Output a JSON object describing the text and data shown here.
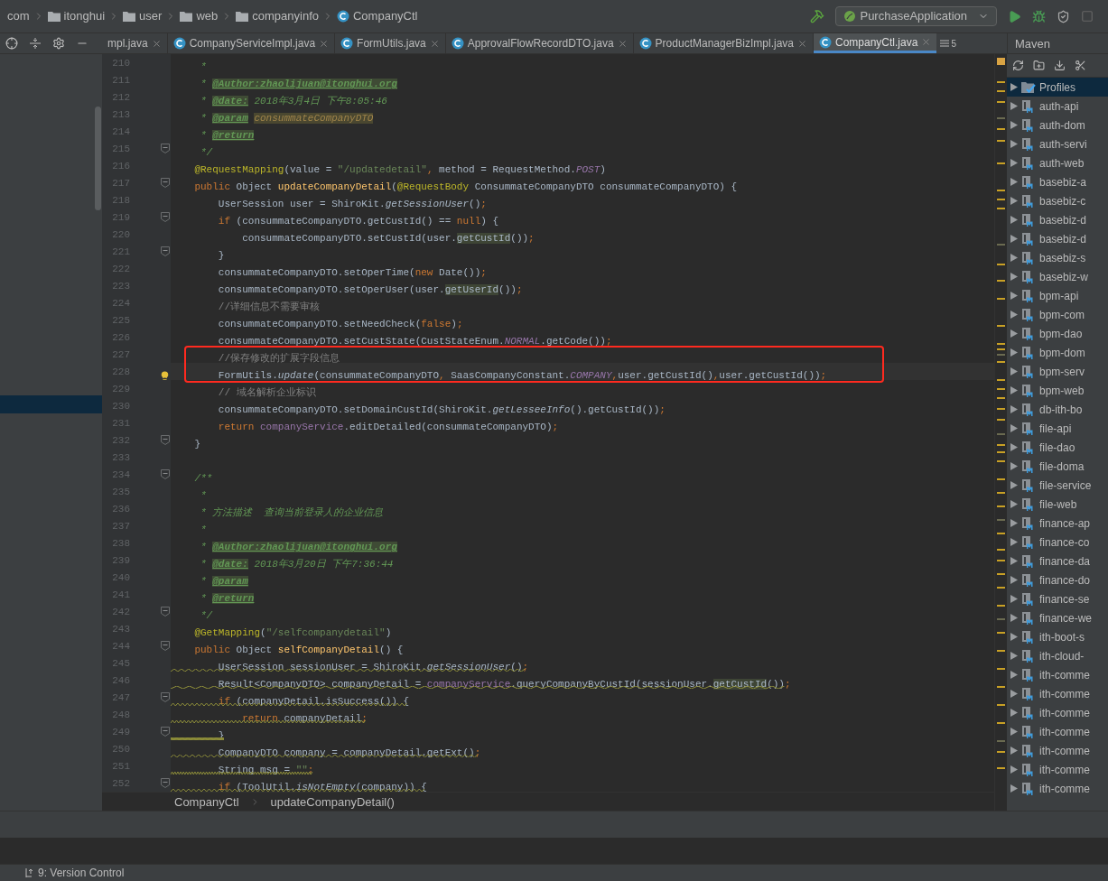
{
  "nav_bar": {
    "crumbs": [
      {
        "kind": "package",
        "label": "com"
      },
      {
        "kind": "folder",
        "label": "itonghui"
      },
      {
        "kind": "folder",
        "label": "user"
      },
      {
        "kind": "folder",
        "label": "web"
      },
      {
        "kind": "folder",
        "label": "companyinfo"
      },
      {
        "kind": "class",
        "label": "CompanyCtl"
      }
    ],
    "run_config": "PurchaseApplication"
  },
  "tabs": [
    {
      "label": "mpl.java",
      "selected": false
    },
    {
      "label": "CompanyServiceImpl.java",
      "selected": false
    },
    {
      "label": "FormUtils.java",
      "selected": false
    },
    {
      "label": "ApprovalFlowRecordDTO.java",
      "selected": false
    },
    {
      "label": "ProductManagerBizImpl.java",
      "selected": false
    },
    {
      "label": "CompanyCtl.java",
      "selected": true
    }
  ],
  "tab_overflow_count": "5",
  "editor": {
    "lines": [
      {
        "number": "210",
        "fold": false,
        "current": false,
        "warning": false,
        "tokens": [
          {
            "kind": "doc",
            "text": "     *"
          }
        ]
      },
      {
        "number": "211",
        "fold": false,
        "current": false,
        "warning": false,
        "tokens": [
          {
            "kind": "doc",
            "text": "     * "
          },
          {
            "kind": "doctag",
            "text": "@Author:zhaolijuan@itonghui.org"
          }
        ]
      },
      {
        "number": "212",
        "fold": false,
        "current": false,
        "warning": false,
        "tokens": [
          {
            "kind": "doc",
            "text": "     * "
          },
          {
            "kind": "doctag",
            "text": "@date:"
          },
          {
            "kind": "doc",
            "text": " 2018年3月4日 下午8:05:46"
          }
        ]
      },
      {
        "number": "213",
        "fold": false,
        "current": false,
        "warning": false,
        "tokens": [
          {
            "kind": "doc",
            "text": "     * "
          },
          {
            "kind": "doctag",
            "text": "@param"
          },
          {
            "kind": "docparam",
            "text": "consummateCompanyDTO"
          }
        ]
      },
      {
        "number": "214",
        "fold": false,
        "current": false,
        "warning": false,
        "tokens": [
          {
            "kind": "doc",
            "text": "     * "
          },
          {
            "kind": "doctag",
            "text": "@return"
          }
        ]
      },
      {
        "number": "215",
        "fold": true,
        "current": false,
        "warning": false,
        "tokens": [
          {
            "kind": "doc",
            "text": "     */"
          }
        ]
      },
      {
        "number": "216",
        "fold": false,
        "current": false,
        "warning": false,
        "tokens": [
          {
            "kind": "annotation",
            "text": "    @RequestMapping"
          },
          {
            "kind": "plain",
            "text": "(value = "
          },
          {
            "kind": "string",
            "text": "\"/updatedetail\""
          },
          {
            "kind": "keyword",
            "text": ","
          },
          {
            "kind": "plain",
            "text": " method = RequestMethod."
          },
          {
            "kind": "constant",
            "text": "POST"
          },
          {
            "kind": "plain",
            "text": ")"
          }
        ]
      },
      {
        "number": "217",
        "fold": true,
        "current": false,
        "warning": false,
        "tokens": [
          {
            "kind": "keyword",
            "text": "    public"
          },
          {
            "kind": "plain",
            "text": " Object "
          },
          {
            "kind": "method",
            "text": "updateCompanyDetail"
          },
          {
            "kind": "plain",
            "text": "("
          },
          {
            "kind": "annotation",
            "text": "@RequestBody"
          },
          {
            "kind": "plain",
            "text": " ConsummateCompanyDTO consummateCompanyDTO) {"
          }
        ]
      },
      {
        "number": "218",
        "fold": false,
        "current": false,
        "warning": false,
        "tokens": [
          {
            "kind": "plain",
            "text": "        UserSession user = ShiroKit."
          },
          {
            "kind": "static",
            "text": "getSessionUser"
          },
          {
            "kind": "plain",
            "text": "()"
          },
          {
            "kind": "keyword",
            "text": ";"
          }
        ]
      },
      {
        "number": "219",
        "fold": true,
        "current": false,
        "warning": false,
        "tokens": [
          {
            "kind": "keyword",
            "text": "        if"
          },
          {
            "kind": "plain",
            "text": " (consummateCompanyDTO.getCustId() == "
          },
          {
            "kind": "keyword",
            "text": "null"
          },
          {
            "kind": "plain",
            "text": ") {"
          }
        ]
      },
      {
        "number": "220",
        "fold": false,
        "current": false,
        "warning": false,
        "tokens": [
          {
            "kind": "plain",
            "text": "            consummateCompanyDTO.setCustId(user."
          },
          {
            "kind": "usage",
            "text": "getCustId"
          },
          {
            "kind": "plain",
            "text": "())"
          },
          {
            "kind": "keyword",
            "text": ";"
          }
        ]
      },
      {
        "number": "221",
        "fold": true,
        "current": false,
        "warning": false,
        "tokens": [
          {
            "kind": "plain",
            "text": "        }"
          }
        ]
      },
      {
        "number": "222",
        "fold": false,
        "current": false,
        "warning": false,
        "tokens": [
          {
            "kind": "plain",
            "text": "        consummateCompanyDTO.setOperTime("
          },
          {
            "kind": "keyword",
            "text": "new"
          },
          {
            "kind": "plain",
            "text": " Date())"
          },
          {
            "kind": "keyword",
            "text": ";"
          }
        ]
      },
      {
        "number": "223",
        "fold": false,
        "current": false,
        "warning": false,
        "tokens": [
          {
            "kind": "plain",
            "text": "        consummateCompanyDTO.setOperUser(user."
          },
          {
            "kind": "usage",
            "text": "getUserId"
          },
          {
            "kind": "plain",
            "text": "())"
          },
          {
            "kind": "keyword",
            "text": ";"
          }
        ]
      },
      {
        "number": "224",
        "fold": false,
        "current": false,
        "warning": false,
        "tokens": [
          {
            "kind": "comment",
            "text": "        //详细信息不需要审核"
          }
        ]
      },
      {
        "number": "225",
        "fold": false,
        "current": false,
        "warning": false,
        "tokens": [
          {
            "kind": "plain",
            "text": "        consummateCompanyDTO.setNeedCheck("
          },
          {
            "kind": "keyword",
            "text": "false"
          },
          {
            "kind": "plain",
            "text": ")"
          },
          {
            "kind": "keyword",
            "text": ";"
          }
        ]
      },
      {
        "number": "226",
        "fold": false,
        "current": false,
        "warning": false,
        "tokens": [
          {
            "kind": "plain",
            "text": "        consummateCompanyDTO.setCustState(CustStateEnum."
          },
          {
            "kind": "constant",
            "text": "NORMAL"
          },
          {
            "kind": "plain",
            "text": ".getCode())"
          },
          {
            "kind": "keyword",
            "text": ";"
          }
        ]
      },
      {
        "number": "227",
        "fold": false,
        "current": false,
        "warning": false,
        "tokens": [
          {
            "kind": "comment",
            "text": "        //保存修改的扩展字段信息"
          }
        ]
      },
      {
        "number": "228",
        "fold": false,
        "current": true,
        "warning": false,
        "tokens": [
          {
            "kind": "plain",
            "text": "        FormUtils."
          },
          {
            "kind": "static",
            "text": "update"
          },
          {
            "kind": "plain",
            "text": "(consummateCompanyDTO"
          },
          {
            "kind": "keyword",
            "text": ","
          },
          {
            "kind": "plain",
            "text": " SaasCompanyConstant."
          },
          {
            "kind": "constant",
            "text": "COMPANY"
          },
          {
            "kind": "keyword",
            "text": ","
          },
          {
            "kind": "plain",
            "text": "user.getCustId()"
          },
          {
            "kind": "keyword",
            "text": ","
          },
          {
            "kind": "plain",
            "text": "user.getCustId())"
          },
          {
            "kind": "keyword",
            "text": ";"
          }
        ]
      },
      {
        "number": "229",
        "fold": false,
        "current": false,
        "warning": false,
        "tokens": [
          {
            "kind": "comment",
            "text": "        // 域名解析企业标识"
          }
        ]
      },
      {
        "number": "230",
        "fold": false,
        "current": false,
        "warning": false,
        "tokens": [
          {
            "kind": "plain",
            "text": "        consummateCompanyDTO.setDomainCustId(ShiroKit."
          },
          {
            "kind": "static",
            "text": "getLesseeInfo"
          },
          {
            "kind": "plain",
            "text": "().getCustId())"
          },
          {
            "kind": "keyword",
            "text": ";"
          }
        ]
      },
      {
        "number": "231",
        "fold": false,
        "current": false,
        "warning": false,
        "tokens": [
          {
            "kind": "keyword",
            "text": "        return"
          },
          {
            "kind": "field",
            "text": " companyService"
          },
          {
            "kind": "plain",
            "text": ".editDetailed(consummateCompanyDTO)"
          },
          {
            "kind": "keyword",
            "text": ";"
          }
        ]
      },
      {
        "number": "232",
        "fold": true,
        "current": false,
        "warning": false,
        "tokens": [
          {
            "kind": "plain",
            "text": "    }"
          }
        ]
      },
      {
        "number": "233",
        "fold": false,
        "current": false,
        "warning": false
      },
      {
        "number": "234",
        "fold": true,
        "current": false,
        "warning": false,
        "tokens": [
          {
            "kind": "doc",
            "text": "    /**"
          }
        ]
      },
      {
        "number": "235",
        "fold": false,
        "current": false,
        "warning": false,
        "tokens": [
          {
            "kind": "doc",
            "text": "     *"
          }
        ]
      },
      {
        "number": "236",
        "fold": false,
        "current": false,
        "warning": false,
        "tokens": [
          {
            "kind": "doc",
            "text": "     * 方法描述  查询当前登录人的企业信息"
          }
        ]
      },
      {
        "number": "237",
        "fold": false,
        "current": false,
        "warning": false,
        "tokens": [
          {
            "kind": "doc",
            "text": "     *"
          }
        ]
      },
      {
        "number": "238",
        "fold": false,
        "current": false,
        "warning": false,
        "tokens": [
          {
            "kind": "doc",
            "text": "     * "
          },
          {
            "kind": "doctag",
            "text": "@Author:zhaolijuan@itonghui.org"
          }
        ]
      },
      {
        "number": "239",
        "fold": false,
        "current": false,
        "warning": false,
        "tokens": [
          {
            "kind": "doc",
            "text": "     * "
          },
          {
            "kind": "doctag",
            "text": "@date:"
          },
          {
            "kind": "doc",
            "text": " 2018年3月20日 下午7:36:44"
          }
        ]
      },
      {
        "number": "240",
        "fold": false,
        "current": false,
        "warning": false,
        "tokens": [
          {
            "kind": "doc",
            "text": "     * "
          },
          {
            "kind": "doctag",
            "text": "@param"
          }
        ]
      },
      {
        "number": "241",
        "fold": false,
        "current": false,
        "warning": false,
        "tokens": [
          {
            "kind": "doc",
            "text": "     * "
          },
          {
            "kind": "doctag",
            "text": "@return"
          }
        ]
      },
      {
        "number": "242",
        "fold": true,
        "current": false,
        "warning": false,
        "tokens": [
          {
            "kind": "doc",
            "text": "     */"
          }
        ]
      },
      {
        "number": "243",
        "fold": false,
        "current": false,
        "warning": false,
        "tokens": [
          {
            "kind": "annotation",
            "text": "    @GetMapping"
          },
          {
            "kind": "plain",
            "text": "("
          },
          {
            "kind": "string",
            "text": "\"/selfcompanydetail\""
          },
          {
            "kind": "plain",
            "text": ")"
          }
        ]
      },
      {
        "number": "244",
        "fold": true,
        "current": false,
        "warning": false,
        "tokens": [
          {
            "kind": "keyword",
            "text": "    public"
          },
          {
            "kind": "plain",
            "text": " Object "
          },
          {
            "kind": "method",
            "text": "selfCompanyDetail"
          },
          {
            "kind": "plain",
            "text": "() {"
          }
        ]
      },
      {
        "number": "245",
        "fold": false,
        "current": false,
        "warning": true,
        "tokens": [
          {
            "kind": "plain",
            "text": "        UserSession sessionUser = ShiroKit."
          },
          {
            "kind": "static",
            "text": "getSessionUser"
          },
          {
            "kind": "plain",
            "text": "()"
          },
          {
            "kind": "keyword",
            "text": ";"
          }
        ]
      },
      {
        "number": "246",
        "fold": false,
        "current": false,
        "warning": true,
        "tokens": [
          {
            "kind": "plain",
            "text": "        Result<CompanyDTO> companyDetail = "
          },
          {
            "kind": "field",
            "text": "companyService"
          },
          {
            "kind": "plain",
            "text": ".queryCompanyByCustId(sessionUser."
          },
          {
            "kind": "usage",
            "text": "getCustId"
          },
          {
            "kind": "plain",
            "text": "())"
          },
          {
            "kind": "keyword",
            "text": ";"
          }
        ]
      },
      {
        "number": "247",
        "fold": true,
        "current": false,
        "warning": true,
        "tokens": [
          {
            "kind": "keyword",
            "text": "        if"
          },
          {
            "kind": "plain",
            "text": " (companyDetail.isSuccess()) {"
          }
        ]
      },
      {
        "number": "248",
        "fold": false,
        "current": false,
        "warning": true,
        "tokens": [
          {
            "kind": "keyword",
            "text": "            return"
          },
          {
            "kind": "plain",
            "text": " companyDetail"
          },
          {
            "kind": "keyword",
            "text": ";"
          }
        ]
      },
      {
        "number": "249",
        "fold": true,
        "current": false,
        "warning": true,
        "tokens": [
          {
            "kind": "plain",
            "text": "        }"
          }
        ]
      },
      {
        "number": "250",
        "fold": false,
        "current": false,
        "warning": true,
        "tokens": [
          {
            "kind": "plain",
            "text": "        CompanyDTO company = companyDetail.getExt()"
          },
          {
            "kind": "keyword",
            "text": ";"
          }
        ]
      },
      {
        "number": "251",
        "fold": false,
        "current": false,
        "warning": true,
        "tokens": [
          {
            "kind": "plain",
            "text": "        String msg = "
          },
          {
            "kind": "string",
            "text": "\"\""
          },
          {
            "kind": "keyword",
            "text": ";"
          }
        ]
      },
      {
        "number": "252",
        "fold": true,
        "current": false,
        "warning": true,
        "tokens": [
          {
            "kind": "keyword",
            "text": "        if"
          },
          {
            "kind": "plain",
            "text": " (ToolUtil."
          },
          {
            "kind": "static",
            "text": "isNotEmpty"
          },
          {
            "kind": "plain",
            "text": "(company)) {"
          }
        ]
      }
    ],
    "breadcrumb": [
      "CompanyCtl",
      "updateCompanyDetail()"
    ]
  },
  "maven": {
    "title": "Maven",
    "items": [
      {
        "label": "Profiles",
        "kind": "profiles",
        "selected": true
      },
      {
        "label": "auth-api",
        "kind": "module",
        "selected": false
      },
      {
        "label": "auth-dom",
        "kind": "module",
        "selected": false
      },
      {
        "label": "auth-servi",
        "kind": "module",
        "selected": false
      },
      {
        "label": "auth-web",
        "kind": "module",
        "selected": false
      },
      {
        "label": "basebiz-a",
        "kind": "module",
        "selected": false
      },
      {
        "label": "basebiz-c",
        "kind": "module",
        "selected": false
      },
      {
        "label": "basebiz-d",
        "kind": "module",
        "selected": false
      },
      {
        "label": "basebiz-d",
        "kind": "module",
        "selected": false
      },
      {
        "label": "basebiz-s",
        "kind": "module",
        "selected": false
      },
      {
        "label": "basebiz-w",
        "kind": "module",
        "selected": false
      },
      {
        "label": "bpm-api",
        "kind": "module",
        "selected": false
      },
      {
        "label": "bpm-com",
        "kind": "module",
        "selected": false
      },
      {
        "label": "bpm-dao",
        "kind": "module",
        "selected": false
      },
      {
        "label": "bpm-dom",
        "kind": "module",
        "selected": false
      },
      {
        "label": "bpm-serv",
        "kind": "module",
        "selected": false
      },
      {
        "label": "bpm-web",
        "kind": "module",
        "selected": false
      },
      {
        "label": "db-ith-bo",
        "kind": "module",
        "selected": false
      },
      {
        "label": "file-api",
        "kind": "module",
        "selected": false
      },
      {
        "label": "file-dao",
        "kind": "module",
        "selected": false
      },
      {
        "label": "file-doma",
        "kind": "module",
        "selected": false
      },
      {
        "label": "file-service",
        "kind": "module",
        "selected": false
      },
      {
        "label": "file-web",
        "kind": "module",
        "selected": false
      },
      {
        "label": "finance-ap",
        "kind": "module",
        "selected": false
      },
      {
        "label": "finance-co",
        "kind": "module",
        "selected": false
      },
      {
        "label": "finance-da",
        "kind": "module",
        "selected": false
      },
      {
        "label": "finance-do",
        "kind": "module",
        "selected": false
      },
      {
        "label": "finance-se",
        "kind": "module",
        "selected": false
      },
      {
        "label": "finance-we",
        "kind": "module",
        "selected": false
      },
      {
        "label": "ith-boot-s",
        "kind": "module",
        "selected": false
      },
      {
        "label": "ith-cloud-",
        "kind": "module",
        "selected": false
      },
      {
        "label": "ith-comme",
        "kind": "module",
        "selected": false
      },
      {
        "label": "ith-comme",
        "kind": "module",
        "selected": false
      },
      {
        "label": "ith-comme",
        "kind": "module",
        "selected": false
      },
      {
        "label": "ith-comme",
        "kind": "module",
        "selected": false
      },
      {
        "label": "ith-comme",
        "kind": "module",
        "selected": false
      },
      {
        "label": "ith-comme",
        "kind": "module",
        "selected": false
      },
      {
        "label": "ith-comme",
        "kind": "module",
        "selected": false
      }
    ]
  },
  "status_bar": {
    "tool_window": "9: Version Control"
  }
}
